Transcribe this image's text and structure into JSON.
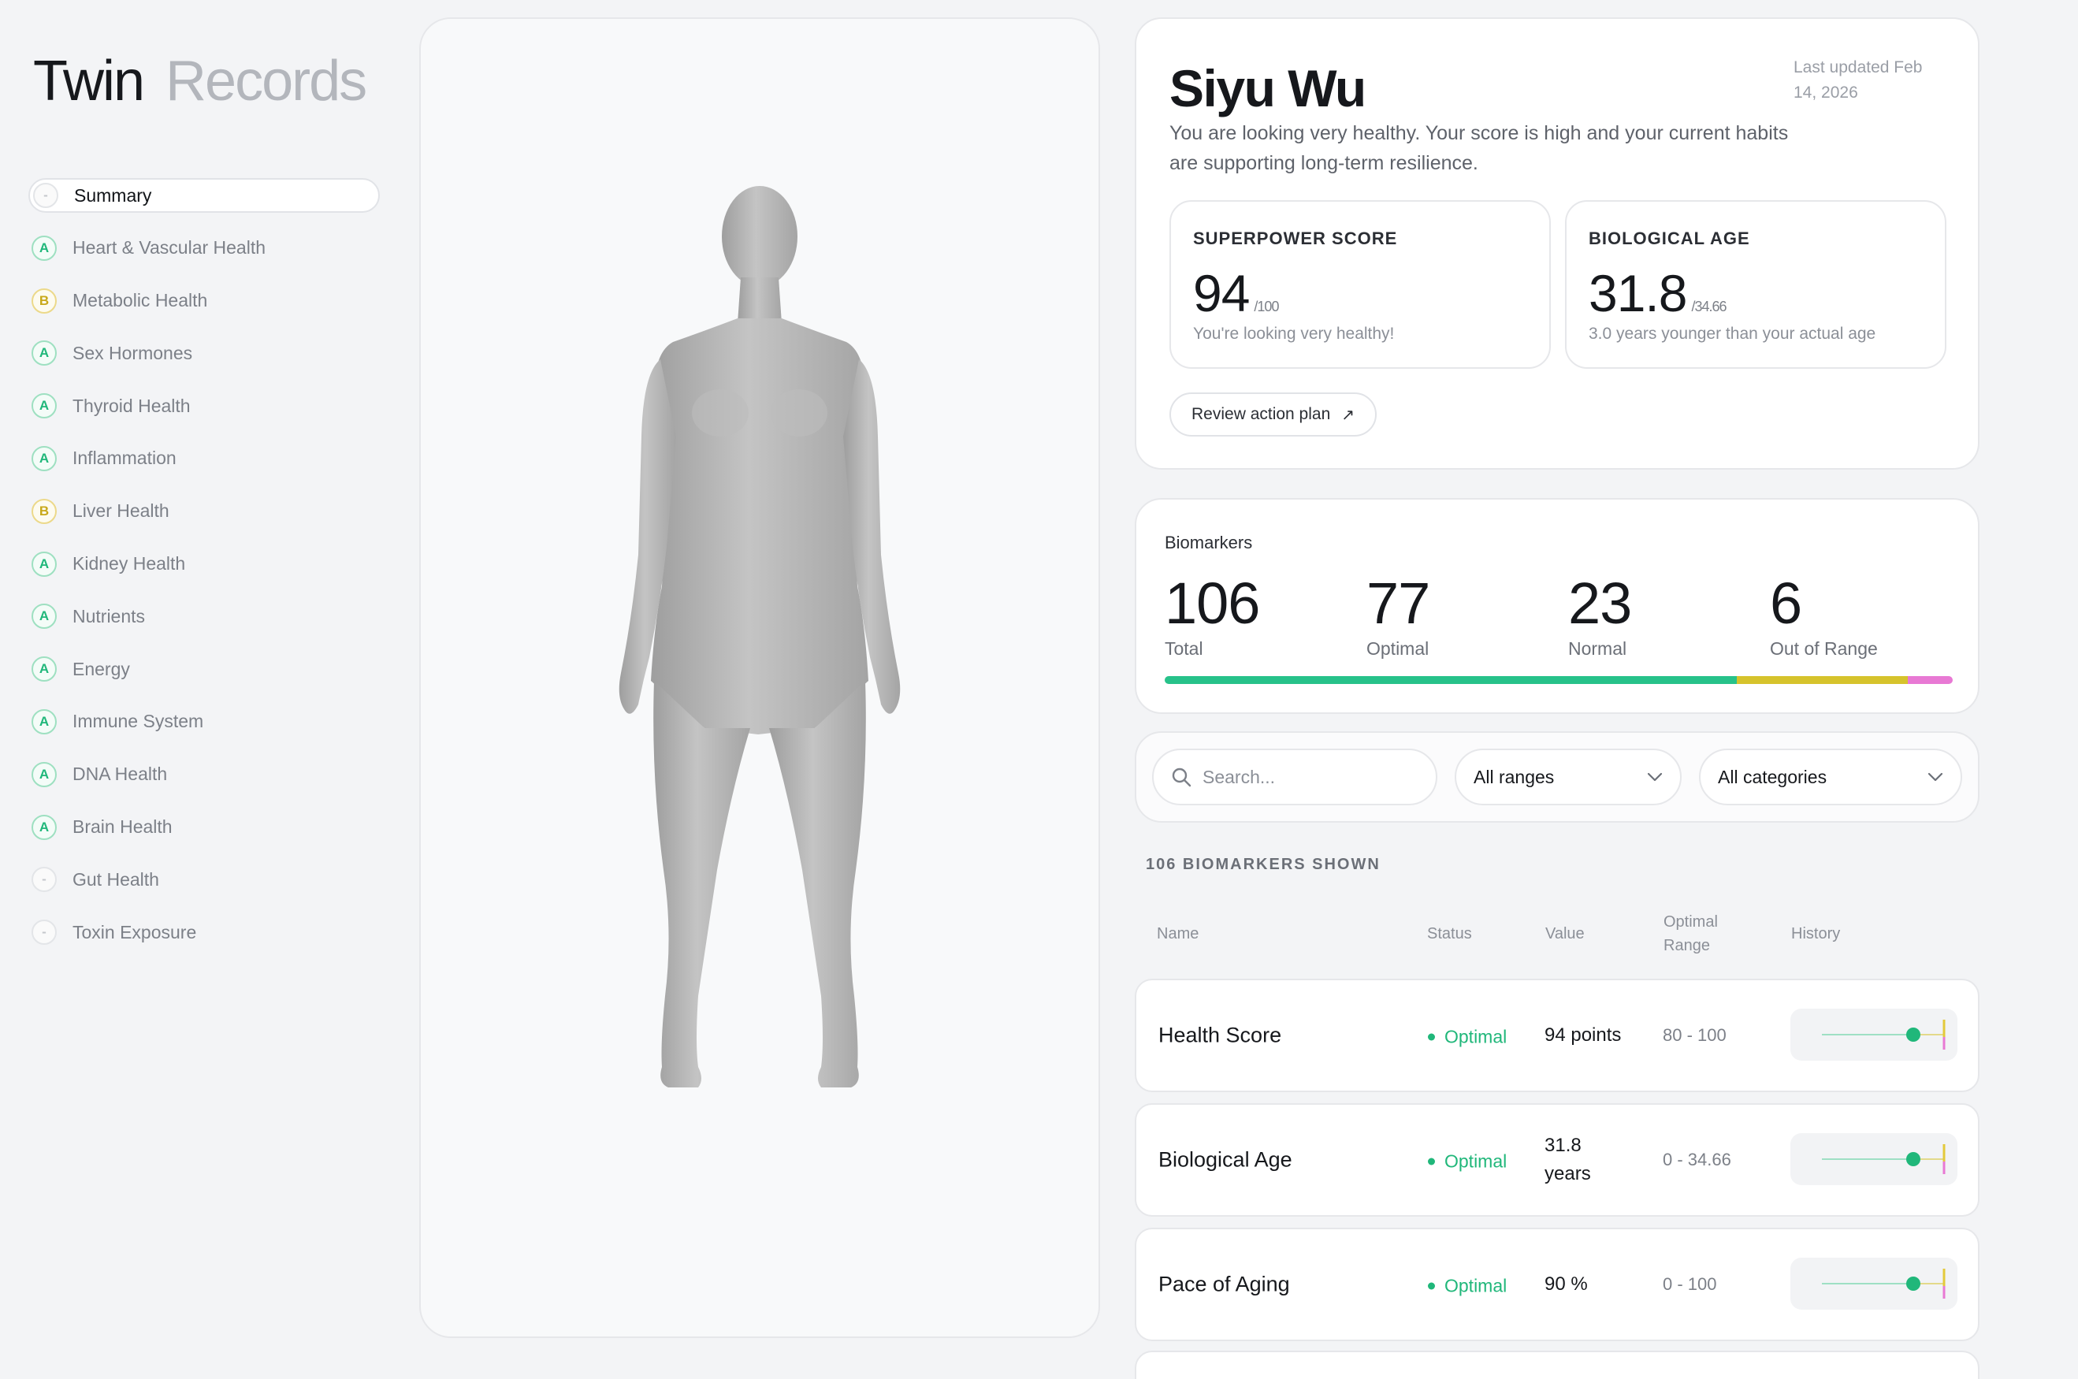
{
  "app": {
    "title_primary": "Twin",
    "title_secondary": "Records"
  },
  "sidebar": {
    "items": [
      {
        "grade": "-",
        "label": "Summary",
        "active": true
      },
      {
        "grade": "A",
        "label": "Heart & Vascular Health"
      },
      {
        "grade": "B",
        "label": "Metabolic Health"
      },
      {
        "grade": "A",
        "label": "Sex Hormones"
      },
      {
        "grade": "A",
        "label": "Thyroid Health"
      },
      {
        "grade": "A",
        "label": "Inflammation"
      },
      {
        "grade": "B",
        "label": "Liver Health"
      },
      {
        "grade": "A",
        "label": "Kidney Health"
      },
      {
        "grade": "A",
        "label": "Nutrients"
      },
      {
        "grade": "A",
        "label": "Energy"
      },
      {
        "grade": "A",
        "label": "Immune System"
      },
      {
        "grade": "A",
        "label": "DNA Health"
      },
      {
        "grade": "A",
        "label": "Brain Health"
      },
      {
        "grade": "-",
        "label": "Gut Health"
      },
      {
        "grade": "-",
        "label": "Toxin Exposure"
      }
    ]
  },
  "profile": {
    "name": "Siyu Wu",
    "last_updated": "Last updated Feb 14, 2026",
    "description": "You are looking very healthy. Your score is high and your current habits are supporting long-term resilience.",
    "superpower": {
      "label": "SUPERPOWER SCORE",
      "value": "94",
      "suffix": "/100",
      "note": "You're looking very healthy!"
    },
    "bio_age": {
      "label": "BIOLOGICAL AGE",
      "value": "31.8",
      "suffix": "/34.66",
      "note": "3.0 years younger than your actual age"
    },
    "action_label": "Review action plan"
  },
  "biomarkers": {
    "title": "Biomarkers",
    "stats": [
      {
        "value": "106",
        "label": "Total"
      },
      {
        "value": "77",
        "label": "Optimal"
      },
      {
        "value": "23",
        "label": "Normal"
      },
      {
        "value": "6",
        "label": "Out of Range"
      }
    ],
    "colors": {
      "optimal": "#27c28a",
      "normal": "#d6c32c",
      "out_of_range": "#e879d4"
    }
  },
  "filters": {
    "search_placeholder": "Search...",
    "range_selected": "All ranges",
    "category_selected": "All categories"
  },
  "table": {
    "shown_label": "106 BIOMARKERS SHOWN",
    "headers": {
      "name": "Name",
      "status": "Status",
      "value": "Value",
      "optimal_range": "Optimal Range",
      "history": "History"
    },
    "rows": [
      {
        "name": "Health Score",
        "status": "Optimal",
        "value": "94 points",
        "range": "80 - 100"
      },
      {
        "name": "Biological Age",
        "status": "Optimal",
        "value": "31.8 years",
        "range": "0 - 34.66"
      },
      {
        "name": "Pace of Aging",
        "status": "Optimal",
        "value": "90 %",
        "range": "0 - 100"
      }
    ]
  }
}
